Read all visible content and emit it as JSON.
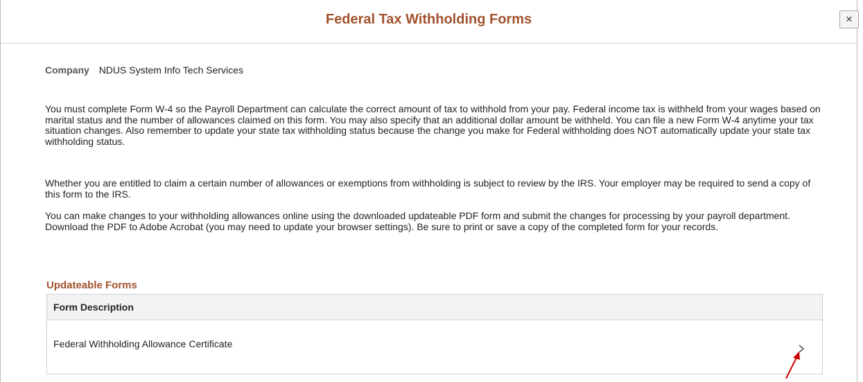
{
  "dialog": {
    "title": "Federal Tax Withholding Forms",
    "close_label": "×"
  },
  "company": {
    "label": "Company",
    "value": "NDUS System Info Tech Services"
  },
  "paragraphs": [
    "You must complete Form W-4 so the Payroll Department can calculate the correct amount of tax to withhold from your pay. Federal income tax is withheld from your wages based on marital status and the number of allowances claimed on this form. You may also specify that an additional dollar amount be withheld. You can file a new Form W-4 anytime your tax situation changes.  Also remember to update your state tax withholding status because the change you make for Federal withholding does NOT automatically update your state tax withholding status.",
    "Whether you are entitled to claim a certain number of allowances or exemptions from withholding is subject to review by the IRS. Your employer may be required to send a copy of this form to the IRS.",
    "You can make changes to your withholding allowances online using the downloaded updateable PDF form and submit the changes for processing by your payroll department. Download the PDF to Adobe Acrobat (you may need to update your browser settings). Be sure to print or save a copy of the completed form for your records."
  ],
  "updateable_forms": {
    "section_title": "Updateable Forms",
    "column_header": "Form Description",
    "rows": [
      {
        "description": "Federal Withholding Allowance Certificate",
        "icon": "chevron-right-icon"
      }
    ]
  },
  "colors": {
    "title": "#a0522d",
    "annotation_arrow": "#cc0000"
  }
}
